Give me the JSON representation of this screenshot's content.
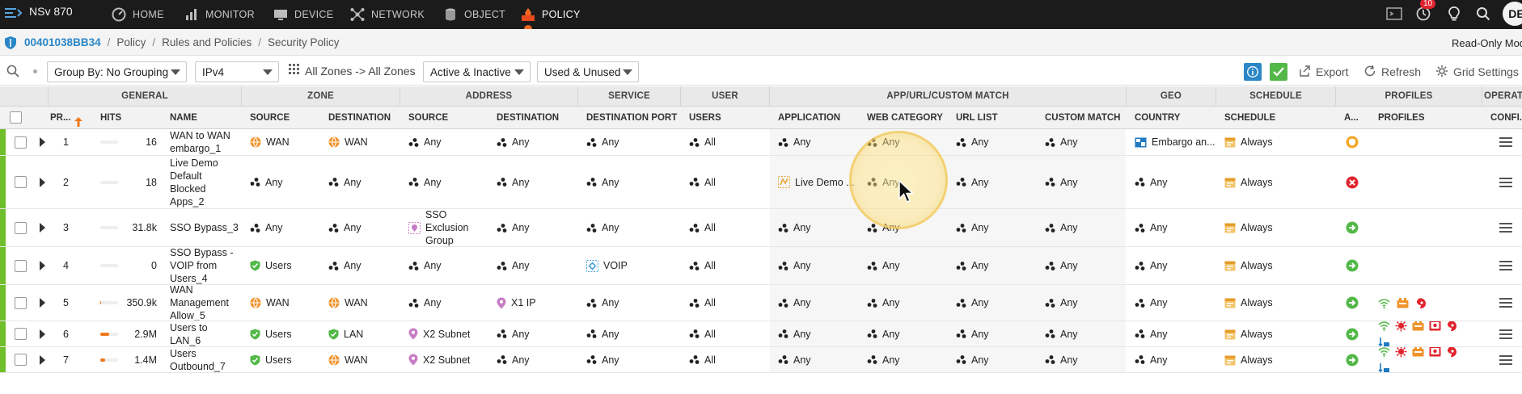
{
  "topnav": {
    "product": "NSv 870",
    "items": [
      {
        "label": "HOME",
        "icon": "dashboard-gauge-icon"
      },
      {
        "label": "MONITOR",
        "icon": "bar-chart-icon"
      },
      {
        "label": "DEVICE",
        "icon": "monitor-icon"
      },
      {
        "label": "NETWORK",
        "icon": "network-nodes-icon"
      },
      {
        "label": "OBJECT",
        "icon": "database-icon"
      },
      {
        "label": "POLICY",
        "icon": "fire-icon"
      }
    ],
    "active": "POLICY",
    "notification_count": "10",
    "user_initials": "DE",
    "accent": "#f26722"
  },
  "breadcrumb": {
    "serial": "00401038BB34",
    "items": [
      "Policy",
      "Rules and Policies",
      "Security Policy"
    ],
    "separator": "/",
    "mode": "Read-Only Mode"
  },
  "toolbar": {
    "group_by": "Group By: No Grouping",
    "ip_version": "IPv4",
    "zones": "All Zones -> All Zones",
    "state_filter": "Active & Inactive",
    "usage_filter": "Used & Unused",
    "export": "Export",
    "refresh": "Refresh",
    "grid_settings": "Grid Settings"
  },
  "groups": [
    "GENERAL",
    "ZONE",
    "ADDRESS",
    "SERVICE",
    "USER",
    "APP/URL/CUSTOM MATCH",
    "GEO",
    "SCHEDULE",
    "PROFILES",
    "OPERATIO"
  ],
  "columns": {
    "priority": "PR...",
    "hits": "HITS",
    "name": "NAME",
    "zone_source": "SOURCE",
    "zone_dest": "DESTINATION",
    "addr_source": "SOURCE",
    "addr_dest": "DESTINATION",
    "dest_port": "DESTINATION PORT",
    "users": "USERS",
    "application": "APPLICATION",
    "web_category": "WEB CATEGORY",
    "url_list": "URL LIST",
    "custom_match": "CUSTOM MATCH",
    "country": "COUNTRY",
    "schedule": "SCHEDULE",
    "action": "A...",
    "profiles": "PROFILES",
    "config": "CONFI..."
  },
  "rows": [
    {
      "priority": "1",
      "hits": "16",
      "hits_fraction": 0.0,
      "name": [
        "WAN to WAN",
        "embargo_1"
      ],
      "zone_source": "WAN",
      "zone_source_icon": "wan-globe-icon",
      "zone_dest": "WAN",
      "zone_dest_icon": "wan-globe-icon",
      "addr_source": [
        "Any"
      ],
      "addr_source_icon": "any-dots-icon",
      "addr_dest": "Any",
      "addr_dest_icon": "any-dots-icon",
      "dest_port": "Any",
      "dest_port_icon": "any-dots-icon",
      "users": "All",
      "application": "Any",
      "application_icon": "any-dots-icon",
      "web_category": "Any",
      "url_list": "Any",
      "custom_match": "Any",
      "country": "Embargo an...",
      "country_icon": "map-icon",
      "schedule": "Always",
      "action": "deny-shield",
      "profiles": []
    },
    {
      "priority": "2",
      "hits": "18",
      "hits_fraction": 0.0,
      "name": [
        "Live Demo",
        "Default",
        "Blocked",
        "Apps_2"
      ],
      "zone_source": "Any",
      "zone_source_icon": "any-dots-icon",
      "zone_dest": "Any",
      "zone_dest_icon": "any-dots-icon",
      "addr_source": [
        "Any"
      ],
      "addr_source_icon": "any-dots-icon",
      "addr_dest": "Any",
      "addr_dest_icon": "any-dots-icon",
      "dest_port": "Any",
      "dest_port_icon": "any-dots-icon",
      "users": "All",
      "application": "Live Demo ...",
      "application_icon": "app-group-icon",
      "web_category": "Any",
      "url_list": "Any",
      "custom_match": "Any",
      "country": "Any",
      "country_icon": "any-dots-icon",
      "schedule": "Always",
      "action": "deny",
      "profiles": []
    },
    {
      "priority": "3",
      "hits": "31.8k",
      "hits_fraction": 0.0,
      "name": [
        "SSO Bypass_3"
      ],
      "zone_source": "Any",
      "zone_source_icon": "any-dots-icon",
      "zone_dest": "Any",
      "zone_dest_icon": "any-dots-icon",
      "addr_source": [
        "SSO",
        "Exclusion",
        "Group"
      ],
      "addr_source_icon": "address-group-icon",
      "addr_dest": "Any",
      "addr_dest_icon": "any-dots-icon",
      "dest_port": "Any",
      "dest_port_icon": "any-dots-icon",
      "users": "All",
      "application": "Any",
      "application_icon": "any-dots-icon",
      "web_category": "Any",
      "url_list": "Any",
      "custom_match": "Any",
      "country": "Any",
      "country_icon": "any-dots-icon",
      "schedule": "Always",
      "action": "allow",
      "profiles": []
    },
    {
      "priority": "4",
      "hits": "0",
      "hits_fraction": 0.0,
      "name": [
        "SSO Bypass -",
        "VOIP from",
        "Users_4"
      ],
      "zone_source": "Users",
      "zone_source_icon": "users-shield-icon",
      "zone_dest": "Any",
      "zone_dest_icon": "any-dots-icon",
      "addr_source": [
        "Any"
      ],
      "addr_source_icon": "any-dots-icon",
      "addr_dest": "Any",
      "addr_dest_icon": "any-dots-icon",
      "dest_port": "VOIP",
      "dest_port_icon": "service-group-icon",
      "users": "All",
      "application": "Any",
      "application_icon": "any-dots-icon",
      "web_category": "Any",
      "url_list": "Any",
      "custom_match": "Any",
      "country": "Any",
      "country_icon": "any-dots-icon",
      "schedule": "Always",
      "action": "allow",
      "profiles": []
    },
    {
      "priority": "5",
      "hits": "350.9k",
      "hits_fraction": 0.06,
      "name": [
        "WAN",
        "Management",
        "Allow_5"
      ],
      "zone_source": "WAN",
      "zone_source_icon": "wan-globe-icon",
      "zone_dest": "WAN",
      "zone_dest_icon": "wan-globe-icon",
      "addr_source": [
        "Any"
      ],
      "addr_source_icon": "any-dots-icon",
      "addr_dest": "X1 IP",
      "addr_dest_icon": "address-pin-icon",
      "dest_port": "Any",
      "dest_port_icon": "any-dots-icon",
      "users": "All",
      "application": "Any",
      "application_icon": "any-dots-icon",
      "web_category": "Any",
      "url_list": "Any",
      "custom_match": "Any",
      "country": "Any",
      "country_icon": "any-dots-icon",
      "schedule": "Always",
      "action": "allow",
      "profiles": [
        "wireless-icon",
        "intrusion-icon",
        "botnet-icon"
      ]
    },
    {
      "priority": "6",
      "hits": "2.9M",
      "hits_fraction": 0.5,
      "name": [
        "Users to",
        "LAN_6"
      ],
      "zone_source": "Users",
      "zone_source_icon": "users-shield-icon",
      "zone_dest": "LAN",
      "zone_dest_icon": "lan-shield-icon",
      "addr_source": [
        "X2 Subnet"
      ],
      "addr_source_icon": "address-pin-icon",
      "addr_dest": "Any",
      "addr_dest_icon": "any-dots-icon",
      "dest_port": "Any",
      "dest_port_icon": "any-dots-icon",
      "users": "All",
      "application": "Any",
      "application_icon": "any-dots-icon",
      "web_category": "Any",
      "url_list": "Any",
      "custom_match": "Any",
      "country": "Any",
      "country_icon": "any-dots-icon",
      "schedule": "Always",
      "action": "allow",
      "profiles": [
        "wireless-icon",
        "virus-icon",
        "intrusion-icon",
        "content-filter-icon",
        "botnet-icon",
        "dpi-ssl-icon"
      ]
    },
    {
      "priority": "7",
      "hits": "1.4M",
      "hits_fraction": 0.25,
      "name": [
        "Users",
        "Outbound_7"
      ],
      "zone_source": "Users",
      "zone_source_icon": "users-shield-icon",
      "zone_dest": "WAN",
      "zone_dest_icon": "wan-globe-icon",
      "addr_source": [
        "X2 Subnet"
      ],
      "addr_source_icon": "address-pin-icon",
      "addr_dest": "Any",
      "addr_dest_icon": "any-dots-icon",
      "dest_port": "Any",
      "dest_port_icon": "any-dots-icon",
      "users": "All",
      "application": "Any",
      "application_icon": "any-dots-icon",
      "web_category": "Any",
      "url_list": "Any",
      "custom_match": "Any",
      "country": "Any",
      "country_icon": "any-dots-icon",
      "schedule": "Always",
      "action": "allow",
      "profiles": [
        "wireless-icon",
        "virus-icon",
        "intrusion-icon",
        "content-filter-icon",
        "botnet-icon",
        "dpi-ssl-icon"
      ]
    }
  ],
  "colors": {
    "enabled_bar": "#6fbf2c",
    "allow": "#53b848",
    "deny": "#e0242e",
    "link": "#2a86c7",
    "hits_bar": "#f07a1e"
  }
}
